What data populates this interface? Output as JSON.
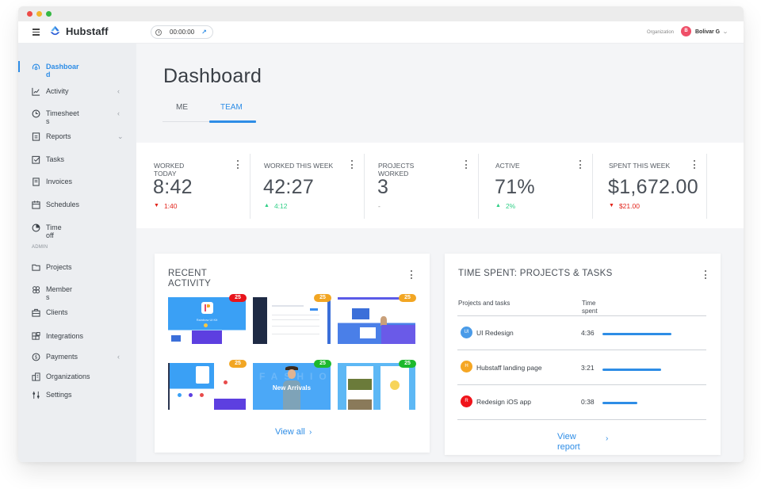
{
  "window": {
    "title_controls": [
      "close",
      "minimize",
      "maximize"
    ]
  },
  "topbar": {
    "menu_icon": "hamburger-icon",
    "brand": "Hubstaff",
    "timer": {
      "value": "00:00:00",
      "clock_icon": "clock-icon",
      "expand_icon": "arrow-up-right-icon"
    },
    "organization_label": "Organization",
    "user": {
      "initial": "B",
      "name": "Bolivar G",
      "avatar_color": "#ef4f68"
    }
  },
  "sidebar": {
    "items": [
      {
        "label": "Dashboard",
        "icon": "dashboard-icon",
        "active": true
      },
      {
        "label": "Activity",
        "icon": "activity-chart-icon",
        "arrow": "‹"
      },
      {
        "label": "Timesheets",
        "icon": "clock-icon",
        "arrow": "‹"
      },
      {
        "label": "Reports",
        "icon": "report-icon",
        "arrow": "⌄"
      },
      {
        "label": "Tasks",
        "icon": "task-check-icon"
      },
      {
        "label": "Invoices",
        "icon": "invoice-icon"
      },
      {
        "label": "Schedules",
        "icon": "calendar-icon"
      },
      {
        "label": "Time off",
        "icon": "time-off-icon"
      }
    ],
    "admin_label": "ADMIN",
    "admin_items": [
      {
        "label": "Projects",
        "icon": "folder-icon"
      },
      {
        "label": "Members",
        "icon": "members-icon"
      },
      {
        "label": "Clients",
        "icon": "briefcase-icon"
      },
      {
        "label": "Integrations",
        "icon": "integrations-icon"
      },
      {
        "label": "Payments",
        "icon": "dollar-circle-icon",
        "arrow": "‹"
      },
      {
        "label": "Organizations",
        "icon": "organization-icon"
      },
      {
        "label": "Settings",
        "icon": "sliders-icon"
      }
    ]
  },
  "main": {
    "title": "Dashboard",
    "tabs": [
      {
        "label": "ME",
        "active": false
      },
      {
        "label": "TEAM",
        "active": true
      }
    ],
    "stats": [
      {
        "label": "WORKED TODAY",
        "value": "8:42",
        "delta": "1:40",
        "trend": "down"
      },
      {
        "label": "WORKED THIS WEEK",
        "value": "42:27",
        "delta": "4:12",
        "trend": "up"
      },
      {
        "label": "PROJECTS WORKED",
        "value": "3",
        "delta": "-",
        "trend": "neutral"
      },
      {
        "label": "ACTIVE",
        "value": "71%",
        "delta": "2%",
        "trend": "up"
      },
      {
        "label": "SPENT THIS WEEK",
        "value": "$1,672.00",
        "delta": "$21.00",
        "trend": "down"
      }
    ],
    "recent_activity": {
      "title": "RECENT ACTIVITY",
      "thumbnails": [
        {
          "name": "Rainbow UI Kit",
          "badge": "25",
          "badge_color": "#e8141b"
        },
        {
          "name": "Dashboard app screenshot",
          "badge": "25",
          "badge_color": "#f2a623"
        },
        {
          "name": "Landing page screenshot",
          "badge": "25",
          "badge_color": "#f2a623"
        },
        {
          "name": "Website layout screenshot",
          "badge": "25",
          "badge_color": "#f2a623"
        },
        {
          "name": "New Arrivals",
          "badge": "25",
          "badge_color": "#1db92c"
        },
        {
          "name": "Mobile app screenshot",
          "badge": "25",
          "badge_color": "#1db92c"
        }
      ],
      "overlay_texts": {
        "rainbow": "Rainbow UI Kit",
        "fashion": "FASHION",
        "new_arrivals": "New Arrivals"
      },
      "view_all": "View all",
      "view_all_chevron": "›"
    },
    "time_spent": {
      "title": "TIME SPENT: PROJECTS & TASKS",
      "columns": [
        "Projects and tasks",
        "Time spent"
      ],
      "rows": [
        {
          "initials": "UI",
          "name": "UI Redesign",
          "time": "4:36",
          "color": "#4a9be8",
          "share": 1.0
        },
        {
          "initials": "H",
          "name": "Hubstaff landing page",
          "time": "3:21",
          "color": "#f5a623",
          "share": 0.85
        },
        {
          "initials": "R",
          "name": "Redesign iOS app",
          "time": "0:38",
          "color": "#f0141b",
          "share": 0.51
        }
      ],
      "view_report": "View report",
      "view_report_chevron": "›"
    }
  }
}
